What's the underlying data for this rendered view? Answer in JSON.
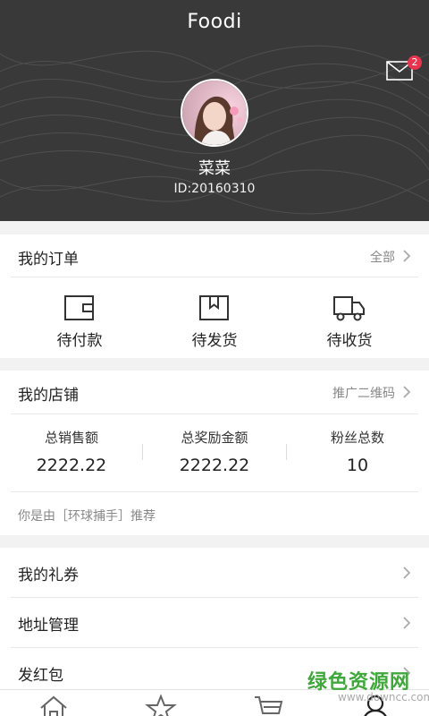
{
  "header": {
    "app_title": "Foodi",
    "mail_badge": "2",
    "username": "菜菜",
    "user_id": "ID:20160310"
  },
  "orders": {
    "title": "我的订单",
    "all_label": "全部",
    "items": [
      {
        "label": "待付款",
        "icon": "wallet-icon"
      },
      {
        "label": "待发货",
        "icon": "box-icon"
      },
      {
        "label": "待收货",
        "icon": "truck-icon"
      }
    ]
  },
  "shop": {
    "title": "我的店铺",
    "qr_label": "推广二维码",
    "stats": [
      {
        "label": "总销售额",
        "value": "2222.22"
      },
      {
        "label": "总奖励金额",
        "value": "2222.22"
      },
      {
        "label": "粉丝总数",
        "value": "10"
      }
    ],
    "referral": "你是由［环球捕手］推荐"
  },
  "menu": [
    {
      "label": "我的礼券"
    },
    {
      "label": "地址管理"
    },
    {
      "label": "发红包"
    }
  ],
  "tabs": [
    {
      "icon": "home-icon"
    },
    {
      "icon": "star-icon"
    },
    {
      "icon": "cart-icon"
    },
    {
      "icon": "user-icon"
    }
  ],
  "watermark": {
    "text": "绿色资源网",
    "url": "www.downcc.com"
  },
  "colors": {
    "header_bg": "#3a3939",
    "badge": "#e8344e",
    "watermark_green": "#3fa83a"
  }
}
